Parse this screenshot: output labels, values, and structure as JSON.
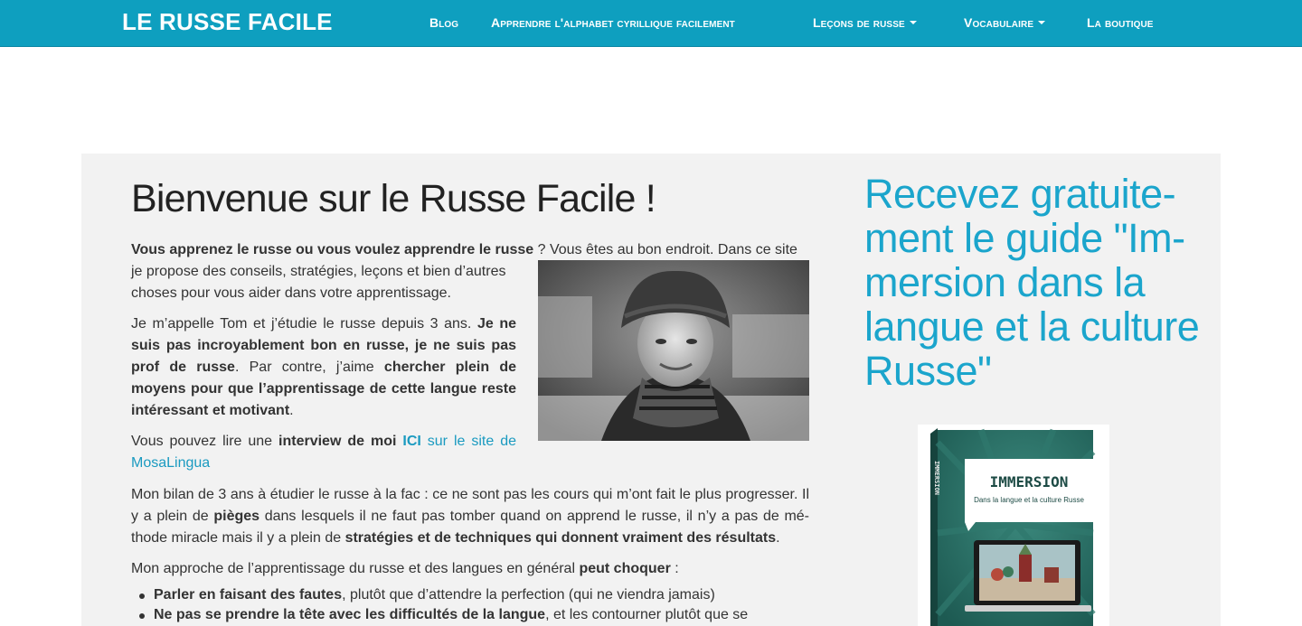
{
  "navbar": {
    "brand": "LE RUSSE FACILE",
    "items": [
      {
        "label": "Blog",
        "dropdown": false
      },
      {
        "label": "Apprendre l'alphabet cyrillique facilement",
        "dropdown": false
      },
      {
        "label": "Leçons de russe",
        "dropdown": true
      },
      {
        "label": "Vocabulaire",
        "dropdown": true
      },
      {
        "label": "La boutique",
        "dropdown": false
      }
    ],
    "color": "#0e9fbf"
  },
  "main": {
    "title": "Bienvenue sur le Russe Facile !",
    "p1": {
      "bold": "Vous apprenez le russe ou vous voulez apprendre le russe",
      "line1_rest": " ? Vous êtes au bon endroit. Dans ce site",
      "line2": "je propose des conseils, stratégies, leçons et bien d’autres",
      "line3": "choses pour vous aider dans votre apprentissage."
    },
    "p2": {
      "t1": "Je m’appelle Tom et j’étudie le russe depuis 3 ans. ",
      "b1": "Je ne suis pas incroyablement bon en russe, je ne suis pas prof de russe",
      "t2": ". Par contre, j’aime ",
      "b2": "chercher plein de moyens pour que l’apprentissage de cette langue reste intéressant et motivant",
      "t3": "."
    },
    "p3": {
      "t1": "Vous pouvez lire une ",
      "b1": "interview de moi ",
      "link1": "ICI",
      "link2": " sur le site de MosaLingua"
    },
    "p4": {
      "t1": "Mon bilan de 3 ans à étudier le russe à la fac : ce ne sont pas les cours qui m’ont fait le plus progresser. Il y a plein de ",
      "b1": "pièges",
      "t2": " dans lesquels il ne faut pas tomber quand on apprend le russe, il n’y a pas de mé-thode miracle mais il y a plein de ",
      "b2": "stratégies et de techniques qui donnent vraiment des résultats",
      "t3": "."
    },
    "p5": {
      "t1": "Mon approche de l’apprentissage du russe et des langues en général ",
      "b1": "peut choquer",
      "t2": " :"
    },
    "bullets": [
      {
        "bold": "Parler en faisant des fautes",
        "rest": ", plutôt que d’attendre la perfection (qui ne viendra jamais)"
      },
      {
        "bold": "Ne pas se prendre la tête avec les difficultés de la langue",
        "rest": ", et les contourner plutôt que se"
      }
    ]
  },
  "sidebar": {
    "title": "Recevez gratuite-ment le guide \"Im-mersion dans la langue et la culture Russe\"",
    "title_color": "#1ba5cc",
    "book": {
      "title": "IMMERSION",
      "subtitle": "Dans la langue et la culture Russe",
      "spine": "IMMERSION"
    }
  }
}
